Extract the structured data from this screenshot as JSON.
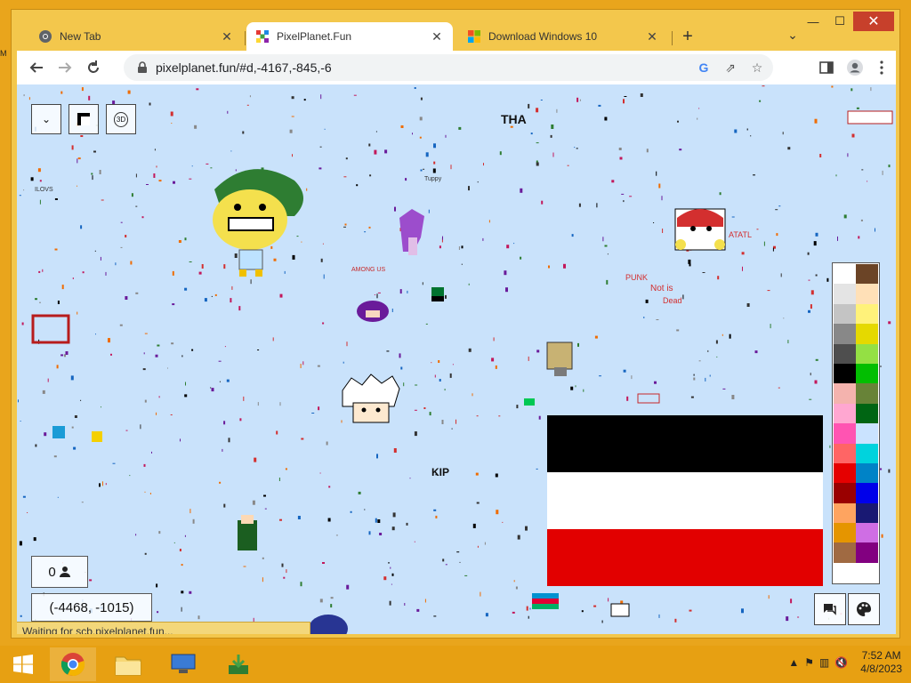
{
  "window": {
    "controls": {
      "minimize": "—",
      "maximize": "☐",
      "close": "✕"
    }
  },
  "tabs": [
    {
      "label": "New Tab",
      "favicon": "chrome-icon"
    },
    {
      "label": "PixelPlanet.Fun",
      "favicon": "pixelplanet-icon",
      "active": true
    },
    {
      "label": "Download Windows 10",
      "favicon": "windows-icon"
    }
  ],
  "toolbar": {
    "url": "pixelplanet.fun/#d,-4167,-845,-6",
    "new_tab_glyph": "+",
    "tab_search_glyph": "⌄"
  },
  "page": {
    "menu_button": "⌄",
    "three_d_button": "3D",
    "online_count": "0",
    "coordinates": "(-4468, -1015)",
    "status_text": "Waiting for scb.pixelplanet.fun..."
  },
  "palette": {
    "colors": [
      "#ffffff",
      "#6b4426",
      "#e4e4e4",
      "#ffe0b7",
      "#c4c4c4",
      "#fff27a",
      "#888888",
      "#e5d900",
      "#4e4e4e",
      "#94e044",
      "#000000",
      "#02be01",
      "#f4b3ae",
      "#688338",
      "#ffa7d1",
      "#006513",
      "#ff54b2",
      "#cae3ff",
      "#ff6565",
      "#00d3dd",
      "#e50000",
      "#0083c7",
      "#9a0000",
      "#0000ea",
      "#fea460",
      "#191973",
      "#e59500",
      "#cf6ee4",
      "#a06a42",
      "#820080"
    ]
  },
  "canvas_labels": {
    "tha": "THA",
    "kip": "KIP",
    "among_us": "AMONG US",
    "punk_not_dead_1": "PUNK",
    "punk_not_dead_2": "Not is",
    "punk_not_dead_3": "Dead",
    "atatl": "ATATL",
    "ilovs": "ILOVS",
    "tuppy": "Tuppy"
  },
  "taskbar": {
    "time": "7:52 AM",
    "date": "4/8/2023"
  }
}
